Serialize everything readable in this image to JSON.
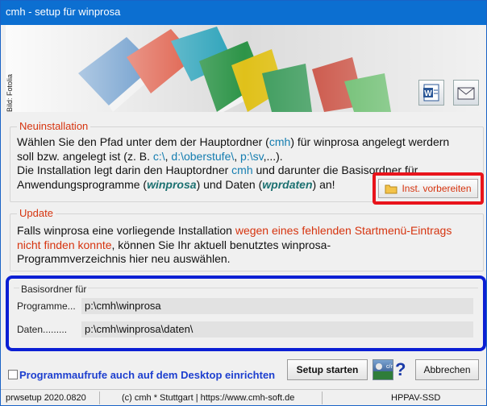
{
  "window": {
    "title": "cmh - setup für winprosa"
  },
  "banner": {
    "credit": "Bild: Fotolia",
    "word_icon": "word-icon",
    "mail_icon": "mail-icon"
  },
  "neuinstallation": {
    "legend": "Neuinstallation",
    "line1_a": "Wählen Sie den Pfad unter dem der Hauptordner (",
    "line1_b": "cmh",
    "line1_c": ") für winprosa angelegt werdern",
    "line2_a": "soll bzw. angelegt ist (z. B. ",
    "line2_b": "c:\\",
    "line2_c": ", ",
    "line2_d": "d:\\oberstufe\\",
    "line2_e": ", ",
    "line2_f": "p:\\sv",
    "line2_g": ",...).",
    "line3_a": "Die Installation legt darin den Hauptordner ",
    "line3_b": "cmh",
    "line3_c": " und darunter die Basisordner für",
    "line4_a": "Anwendungsprogramme (",
    "line4_b": "winprosa",
    "line4_c": ") und Daten  (",
    "line4_d": "wprdaten",
    "line4_e": ") an!",
    "button_label": "Inst. vorbereiten"
  },
  "update": {
    "legend": "Update",
    "line1_a": "Falls winprosa eine vorliegende Installation ",
    "line1_b": "wegen eines fehlenden Startmenü-Eintrags",
    "line2_a": "nicht finden konnte",
    "line2_b": ", können Sie Ihr aktuell benutztes winprosa-",
    "line3": "Programmverzeichnis hier neu auswählen."
  },
  "basisordner": {
    "legend": "Basisordner für",
    "rows": [
      {
        "label": "Programme...",
        "value": "p:\\cmh\\winprosa"
      },
      {
        "label": "Daten.........",
        "value": "p:\\cmh\\winprosa\\daten\\"
      }
    ]
  },
  "bottom": {
    "checkbox_label": "Programmaufrufe auch auf dem Desktop einrichten",
    "setup_button": "Setup starten",
    "help_glyph": "?",
    "cancel_button": "Abbrechen"
  },
  "status": {
    "version": "prwsetup 2020.0820",
    "copyright": "(c) cmh * Stuttgart | https://www.cmh-soft.de",
    "machine": "HPPAV-SSD"
  },
  "colors": {
    "titlebar": "#0c6fd1",
    "accent_red": "#d6340f",
    "highlight_red": "#e8141b",
    "highlight_blue": "#0b1fd4",
    "link_blue": "#147db0"
  }
}
